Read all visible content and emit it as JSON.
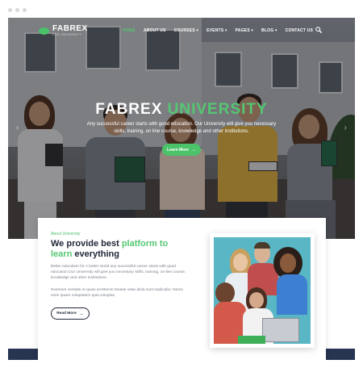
{
  "colors": {
    "accent": "#4cc26a",
    "heading_dark": "#1f2638",
    "footer_navy": "#273553"
  },
  "header": {
    "logo_title": "FABREX",
    "logo_subtitle": "FOR UNIVERSITY",
    "nav": [
      {
        "label": "HOME",
        "active": true
      },
      {
        "label": "ABOUT US"
      },
      {
        "label": "COURSES ▾"
      },
      {
        "label": "EVENTS ▾"
      },
      {
        "label": "PAGES ▾"
      },
      {
        "label": "BLOG ▾"
      },
      {
        "label": "CONTACT US"
      }
    ],
    "search_icon": "search-icon"
  },
  "hero": {
    "title_part1": "FABREX",
    "title_part2": "UNIVERSITY",
    "description": "Any successful career starts with good education. Our University will give you necessary skills, training, on line course, knowledge and other institutions.",
    "button_label": "Learn More",
    "button_arrow": "→",
    "prev_arrow": "‹",
    "next_arrow": "›"
  },
  "about": {
    "label": "About University",
    "heading_part1": "We provide best ",
    "heading_green": "platform to learn",
    "heading_part2": " everything",
    "paragraph1": "Better education for A better world any successful career starts with good education.Our University will give you necessary skills, training, on-line course, knowledge and other institutions.",
    "paragraph2": "Nvemore veritatis et quasi architecto beatae vitae dicta sunt explicabo. Nemo enim ipsam voluptatem quia voluptas.",
    "button_label": "Read More",
    "button_arrow": "→"
  }
}
